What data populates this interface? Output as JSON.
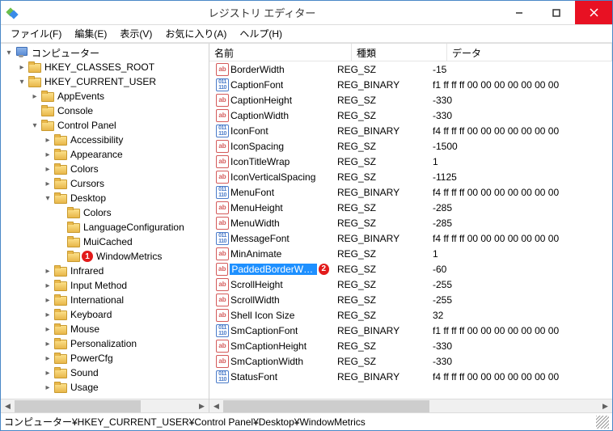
{
  "title": "レジストリ エディター",
  "menus": [
    "ファイル(F)",
    "編集(E)",
    "表示(V)",
    "お気に入り(A)",
    "ヘルプ(H)"
  ],
  "tree": {
    "computer": "コンピューター",
    "hkcr": "HKEY_CLASSES_ROOT",
    "hkcu": "HKEY_CURRENT_USER",
    "cpItems": [
      "AppEvents",
      "Console",
      "Control Panel"
    ],
    "cpSub": [
      "Accessibility",
      "Appearance",
      "Colors",
      "Cursors",
      "Desktop"
    ],
    "deskSub": [
      "Colors",
      "LanguageConfiguration",
      "MuiCached",
      "WindowMetrics"
    ],
    "cpRest": [
      "Infrared",
      "Input Method",
      "International",
      "Keyboard",
      "Mouse",
      "Personalization",
      "PowerCfg",
      "Sound",
      "Usage"
    ]
  },
  "badge1": "1",
  "badge2": "2",
  "columns": {
    "name": "名前",
    "type": "種類",
    "data": "データ"
  },
  "rows": [
    {
      "i": "str",
      "n": "BorderWidth",
      "t": "REG_SZ",
      "d": "-15"
    },
    {
      "i": "bin",
      "n": "CaptionFont",
      "t": "REG_BINARY",
      "d": "f1 ff ff ff 00 00 00 00 00 00 00"
    },
    {
      "i": "str",
      "n": "CaptionHeight",
      "t": "REG_SZ",
      "d": "-330"
    },
    {
      "i": "str",
      "n": "CaptionWidth",
      "t": "REG_SZ",
      "d": "-330"
    },
    {
      "i": "bin",
      "n": "IconFont",
      "t": "REG_BINARY",
      "d": "f4 ff ff ff 00 00 00 00 00 00 00"
    },
    {
      "i": "str",
      "n": "IconSpacing",
      "t": "REG_SZ",
      "d": "-1500"
    },
    {
      "i": "str",
      "n": "IconTitleWrap",
      "t": "REG_SZ",
      "d": "1"
    },
    {
      "i": "str",
      "n": "IconVerticalSpacing",
      "t": "REG_SZ",
      "d": "-1125"
    },
    {
      "i": "bin",
      "n": "MenuFont",
      "t": "REG_BINARY",
      "d": "f4 ff ff ff 00 00 00 00 00 00 00"
    },
    {
      "i": "str",
      "n": "MenuHeight",
      "t": "REG_SZ",
      "d": "-285"
    },
    {
      "i": "str",
      "n": "MenuWidth",
      "t": "REG_SZ",
      "d": "-285"
    },
    {
      "i": "bin",
      "n": "MessageFont",
      "t": "REG_BINARY",
      "d": "f4 ff ff ff 00 00 00 00 00 00 00"
    },
    {
      "i": "str",
      "n": "MinAnimate",
      "t": "REG_SZ",
      "d": "1"
    },
    {
      "i": "str",
      "n": "PaddedBorderWidth",
      "t": "REG_SZ",
      "d": "-60",
      "sel": true
    },
    {
      "i": "str",
      "n": "ScrollHeight",
      "t": "REG_SZ",
      "d": "-255"
    },
    {
      "i": "str",
      "n": "ScrollWidth",
      "t": "REG_SZ",
      "d": "-255"
    },
    {
      "i": "str",
      "n": "Shell Icon Size",
      "t": "REG_SZ",
      "d": "32"
    },
    {
      "i": "bin",
      "n": "SmCaptionFont",
      "t": "REG_BINARY",
      "d": "f1 ff ff ff 00 00 00 00 00 00 00"
    },
    {
      "i": "str",
      "n": "SmCaptionHeight",
      "t": "REG_SZ",
      "d": "-330"
    },
    {
      "i": "str",
      "n": "SmCaptionWidth",
      "t": "REG_SZ",
      "d": "-330"
    },
    {
      "i": "bin",
      "n": "StatusFont",
      "t": "REG_BINARY",
      "d": "f4 ff ff ff 00 00 00 00 00 00 00"
    }
  ],
  "statusPath": "コンピューター¥HKEY_CURRENT_USER¥Control Panel¥Desktop¥WindowMetrics"
}
